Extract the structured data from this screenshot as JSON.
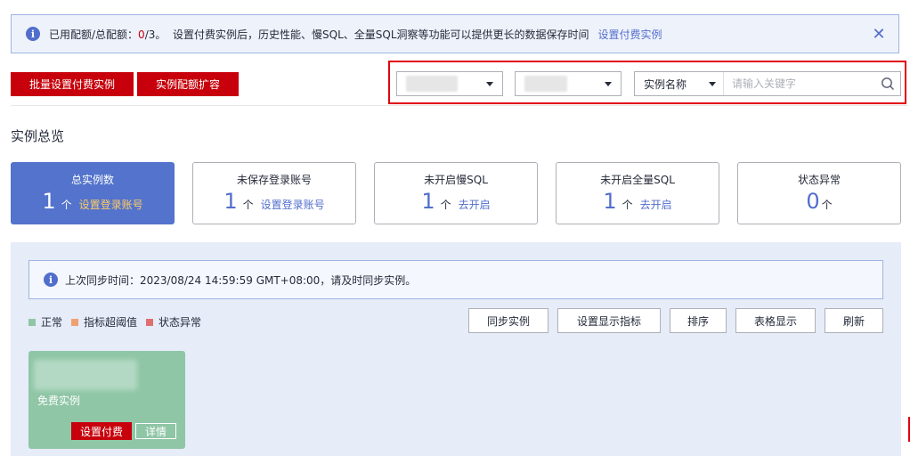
{
  "banner": {
    "prefix": "已用配额/总配额：",
    "quota_used": "0",
    "quota_total": "/3。",
    "message": "设置付费实例后，历史性能、慢SQL、全量SQL洞察等功能可以提供更长的数据保存时间",
    "link": "设置付费实例",
    "close": "✕"
  },
  "actions": {
    "batch_paid": "批量设置付费实例",
    "quota_expand": "实例配额扩容"
  },
  "search": {
    "type_label": "实例名称",
    "placeholder": "请输入关键字"
  },
  "overview": {
    "title": "实例总览",
    "cards": [
      {
        "label": "总实例数",
        "value": "1",
        "unit": "个",
        "link": "设置登录账号"
      },
      {
        "label": "未保存登录账号",
        "value": "1",
        "unit": "个",
        "link": "设置登录账号"
      },
      {
        "label": "未开启慢SQL",
        "value": "1",
        "unit": "个",
        "link": "去开启"
      },
      {
        "label": "未开启全量SQL",
        "value": "1",
        "unit": "个",
        "link": "去开启"
      },
      {
        "label": "状态异常",
        "value": "0",
        "unit": "个"
      }
    ]
  },
  "sync": {
    "text": "上次同步时间：2023/08/24 14:59:59 GMT+08:00，请及时同步实例。"
  },
  "legend": [
    {
      "label": "正常",
      "color": "#8fc6a6"
    },
    {
      "label": "指标超阈值",
      "color": "#f0a070"
    },
    {
      "label": "状态异常",
      "color": "#e07070"
    }
  ],
  "toolbar": {
    "sync": "同步实例",
    "set_metrics": "设置显示指标",
    "sort": "排序",
    "table_view": "表格显示",
    "refresh": "刷新"
  },
  "instance": {
    "status": "免费实例",
    "pay": "设置付费",
    "detail": "详情"
  }
}
